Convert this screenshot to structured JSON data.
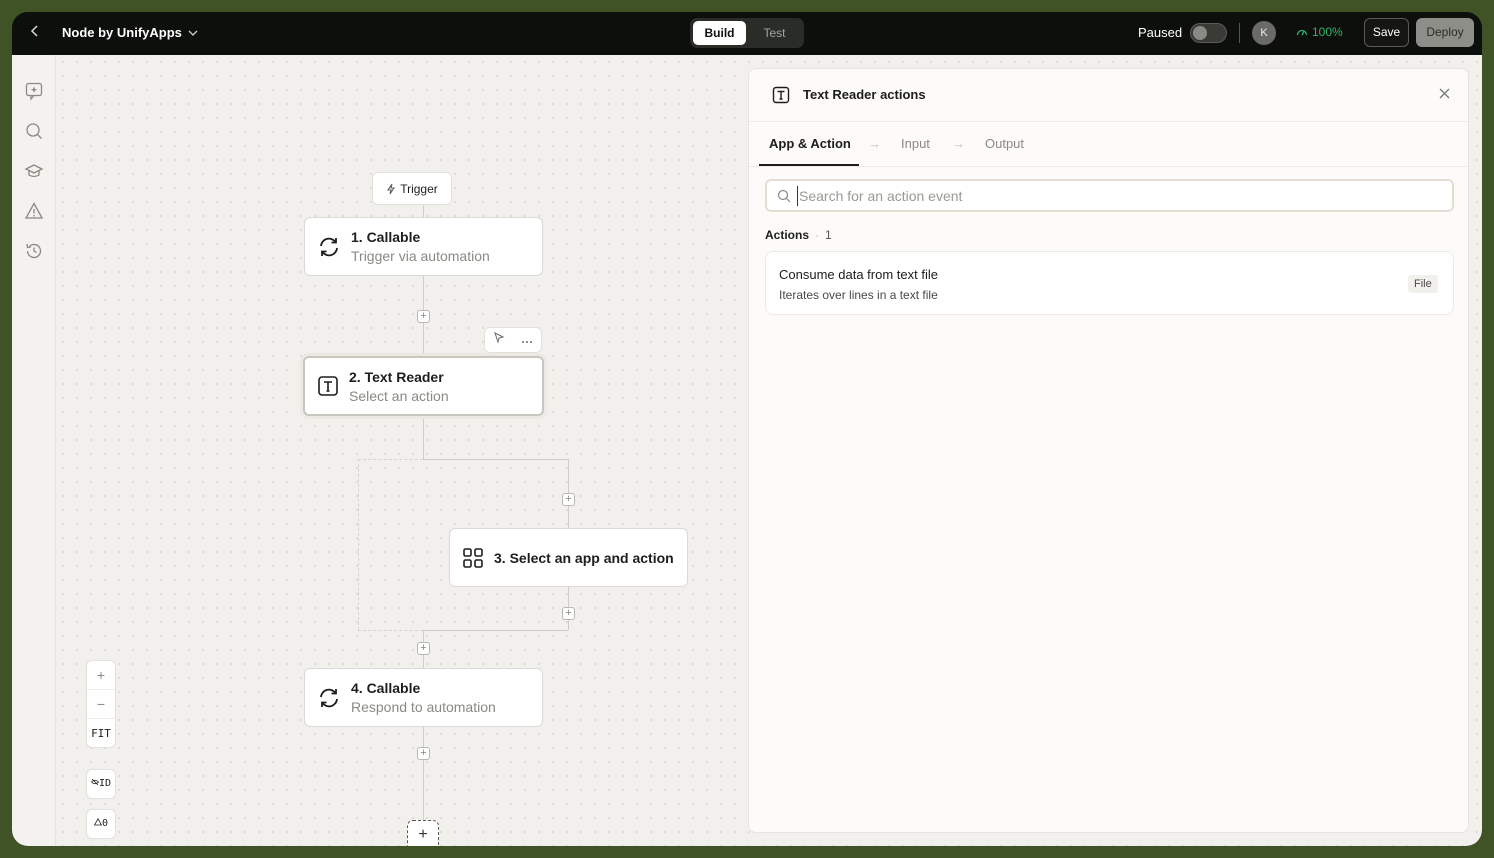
{
  "topbar": {
    "project_name": "Node by UnifyApps",
    "modes": [
      "Build",
      "Test"
    ],
    "active_mode": "Build",
    "status_label": "Paused",
    "avatar_initial": "K",
    "health": "100%",
    "save_label": "Save",
    "deploy_label": "Deploy"
  },
  "rail": {
    "icons": [
      "ai-chat-icon",
      "search-icon",
      "learn-icon",
      "warning-icon",
      "history-icon"
    ]
  },
  "flow": {
    "trigger_label": "Trigger",
    "nodes": [
      {
        "title": "1. Callable",
        "subtitle": "Trigger via automation",
        "icon": "sync-icon"
      },
      {
        "title": "2. Text Reader",
        "subtitle": "Select an action",
        "icon": "text-icon"
      },
      {
        "title": "3. Select an app and action",
        "subtitle": "",
        "icon": "grid-icon"
      },
      {
        "title": "4. Callable",
        "subtitle": "Respond to automation",
        "icon": "sync-icon"
      }
    ]
  },
  "controls": {
    "zoom_in": "+",
    "zoom_out": "−",
    "fit": "FIT",
    "id_toggle": "ID",
    "warnings": "0"
  },
  "panel": {
    "title": "Text Reader actions",
    "tabs": [
      "App & Action",
      "Input",
      "Output"
    ],
    "active_tab": "App & Action",
    "search_placeholder": "Search for an action event",
    "actions_label": "Actions",
    "actions_count": "1",
    "actions": [
      {
        "title": "Consume data from text file",
        "description": "Iterates over lines in a text file",
        "tag": "File"
      }
    ]
  },
  "colors": {
    "accent_dark": "#0d0f0c",
    "health_green": "#2fb36c",
    "outer_frame": "#3f5326"
  }
}
